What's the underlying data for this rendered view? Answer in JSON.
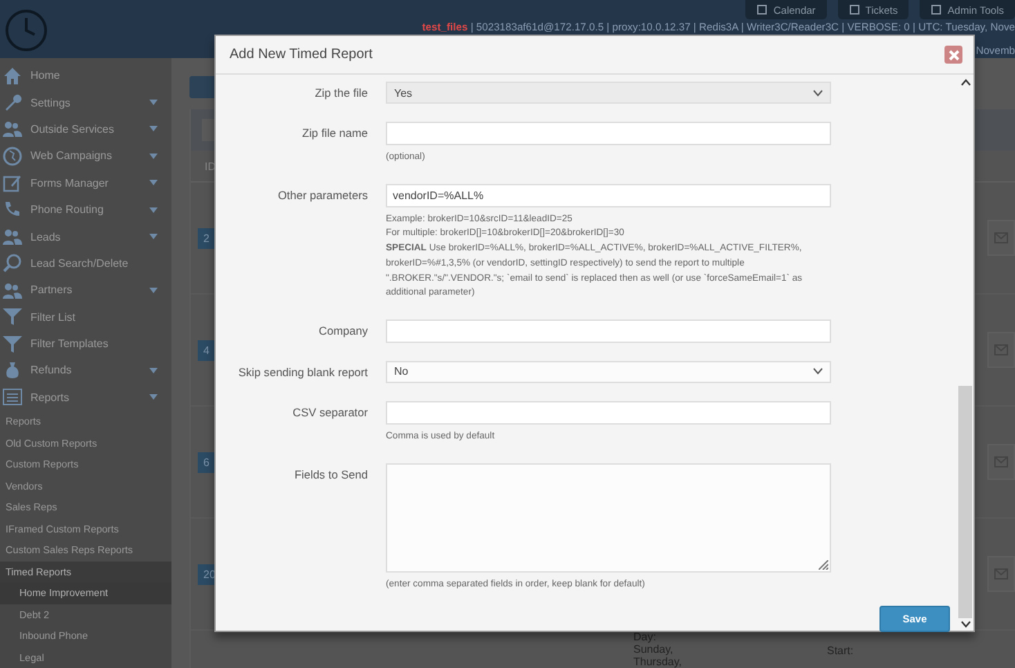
{
  "header": {
    "nav_buttons": [
      {
        "label": "Calendar"
      },
      {
        "label": "Tickets"
      },
      {
        "label": "Admin Tools"
      }
    ],
    "status": {
      "app": "test_files",
      "details": " | 5023183af61d@172.17.0.5 | proxy:10.0.12.37 | Redis3A | Writer3C/Reader3C | VERBOSE: 0 | UTC: Tuesday, Nove",
      "line_2": "Novemb"
    }
  },
  "sidebar": {
    "items": [
      {
        "kind": "menu",
        "label": "Home",
        "caret": false,
        "selected": false
      },
      {
        "kind": "menu",
        "label": "Settings",
        "caret": true,
        "selected": false
      },
      {
        "kind": "menu",
        "label": "Outside Services",
        "caret": true,
        "selected": false
      },
      {
        "kind": "menu",
        "label": "Web Campaigns",
        "caret": true,
        "selected": false
      },
      {
        "kind": "menu",
        "label": "Forms Manager",
        "caret": true,
        "selected": false
      },
      {
        "kind": "menu",
        "label": "Phone Routing",
        "caret": true,
        "selected": false
      },
      {
        "kind": "menu",
        "label": "Leads",
        "caret": true,
        "selected": false
      },
      {
        "kind": "menu",
        "label": "Lead Search/Delete",
        "caret": false,
        "selected": false
      },
      {
        "kind": "menu",
        "label": "Partners",
        "caret": true,
        "selected": false
      },
      {
        "kind": "menu",
        "label": "Filter List",
        "caret": false,
        "selected": false
      },
      {
        "kind": "menu",
        "label": "Filter Templates",
        "caret": false,
        "selected": false
      },
      {
        "kind": "menu",
        "label": "Refunds",
        "caret": true,
        "selected": false
      },
      {
        "kind": "menu",
        "label": "Reports",
        "caret": true,
        "selected": false
      },
      {
        "kind": "sub",
        "label": "Reports",
        "selected": false
      },
      {
        "kind": "sub",
        "label": "Old Custom Reports",
        "selected": false
      },
      {
        "kind": "sub",
        "label": "Custom Reports",
        "selected": false
      },
      {
        "kind": "sub",
        "label": "Vendors",
        "selected": false
      },
      {
        "kind": "sub",
        "label": "Sales Reps",
        "selected": false
      },
      {
        "kind": "sub",
        "label": "IFramed Custom Reports",
        "selected": false
      },
      {
        "kind": "sub",
        "label": "Custom Sales Reps Reports",
        "selected": false
      },
      {
        "kind": "sub",
        "label": "Timed Reports",
        "selected": true,
        "children": [
          {
            "label": "Home Improvement",
            "selected": true
          },
          {
            "label": "Debt 2",
            "selected": false
          },
          {
            "label": "Inbound Phone",
            "selected": false
          },
          {
            "label": "Legal",
            "selected": false
          }
        ]
      }
    ]
  },
  "content": {
    "column_header": "ID",
    "badges": [
      "2",
      "4",
      "6",
      "20"
    ],
    "day_lines": [
      "Day:",
      "Sunday,",
      "Thursday,"
    ],
    "start_label": "Start:"
  },
  "modal": {
    "title": "Add New Timed Report",
    "fields": [
      {
        "kind": "select",
        "label": "Zip the file",
        "value": "Yes",
        "disabled": true
      },
      {
        "kind": "input",
        "label": "Zip file name",
        "help": [
          "(optional)"
        ]
      },
      {
        "kind": "input",
        "label": "Other parameters",
        "value": "vendorID=%ALL%",
        "help": [
          "Example: brokerID=10&srcID=11&leadID=25",
          "For multiple: brokerID[]=10&brokerID[]=20&brokerID[]=30",
          "**SPECIAL** Use brokerID=%ALL%, brokerID=%ALL_ACTIVE%, brokerID=%ALL_ACTIVE_FILTER%, brokerID=%#1,3,5% (or vendorID, settingID respectively) to send the report to multiple \".BROKER.\"s/\".VENDOR.\"s; `email to send` is replaced then as well (or use `forceSameEmail=1` as additional parameter)"
        ]
      },
      {
        "kind": "input",
        "label": "Company"
      },
      {
        "kind": "select",
        "label": "Skip sending blank report",
        "value": "No",
        "disabled": false
      },
      {
        "kind": "input",
        "label": "CSV separator",
        "help": [
          "Comma is used by default"
        ]
      },
      {
        "kind": "textarea",
        "label": "Fields to Send",
        "help": [
          "(enter comma separated fields in order, keep blank for default)"
        ]
      }
    ],
    "save_label": "Save"
  }
}
